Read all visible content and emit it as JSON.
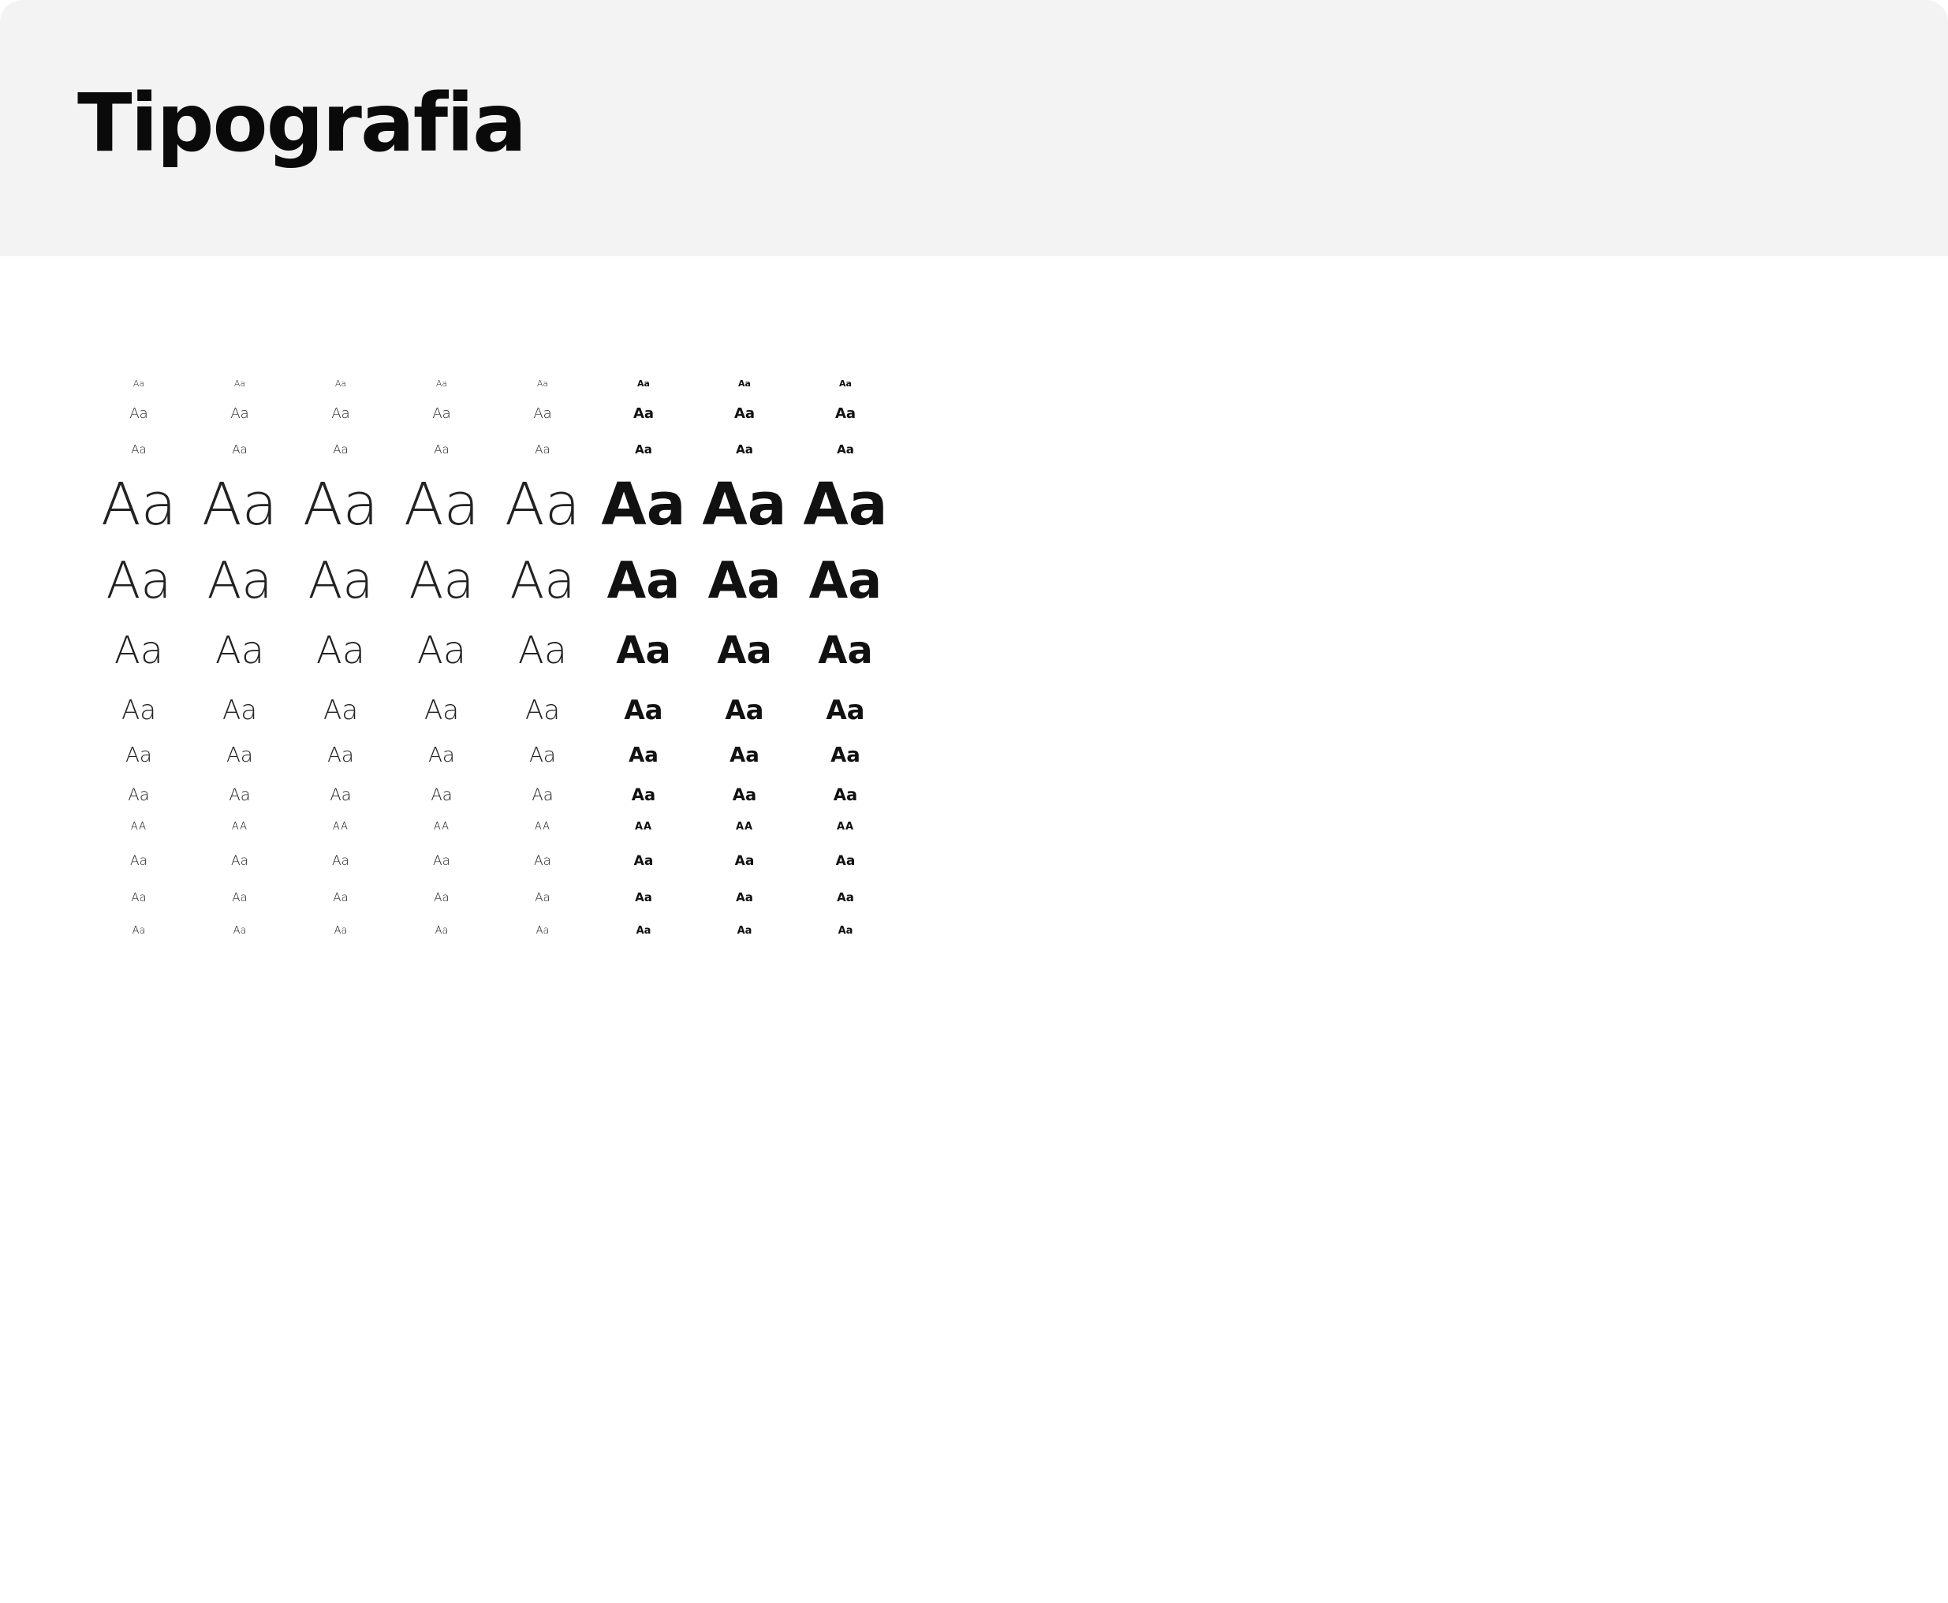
{
  "page": {
    "title": "Tipografia"
  },
  "type_specimen": {
    "columns": [
      "light",
      "light",
      "light",
      "light",
      "light",
      "bold",
      "bold",
      "bold"
    ],
    "rows": [
      {
        "sample": "Aa"
      },
      {
        "sample": "Aa"
      },
      {
        "sample": "Aa"
      },
      {
        "sample": "Aa"
      },
      {
        "sample": "Aa"
      },
      {
        "sample": "Aa"
      },
      {
        "sample": "Aa"
      },
      {
        "sample": "Aa"
      },
      {
        "sample": "Aa"
      },
      {
        "sample": "AA"
      },
      {
        "sample": "Aa"
      },
      {
        "sample": "Aa"
      },
      {
        "sample": "Aa"
      }
    ]
  },
  "colors": {
    "header_background": "#f3f3f3",
    "page_background": "#ffffff",
    "text": "#1a1a1a"
  }
}
